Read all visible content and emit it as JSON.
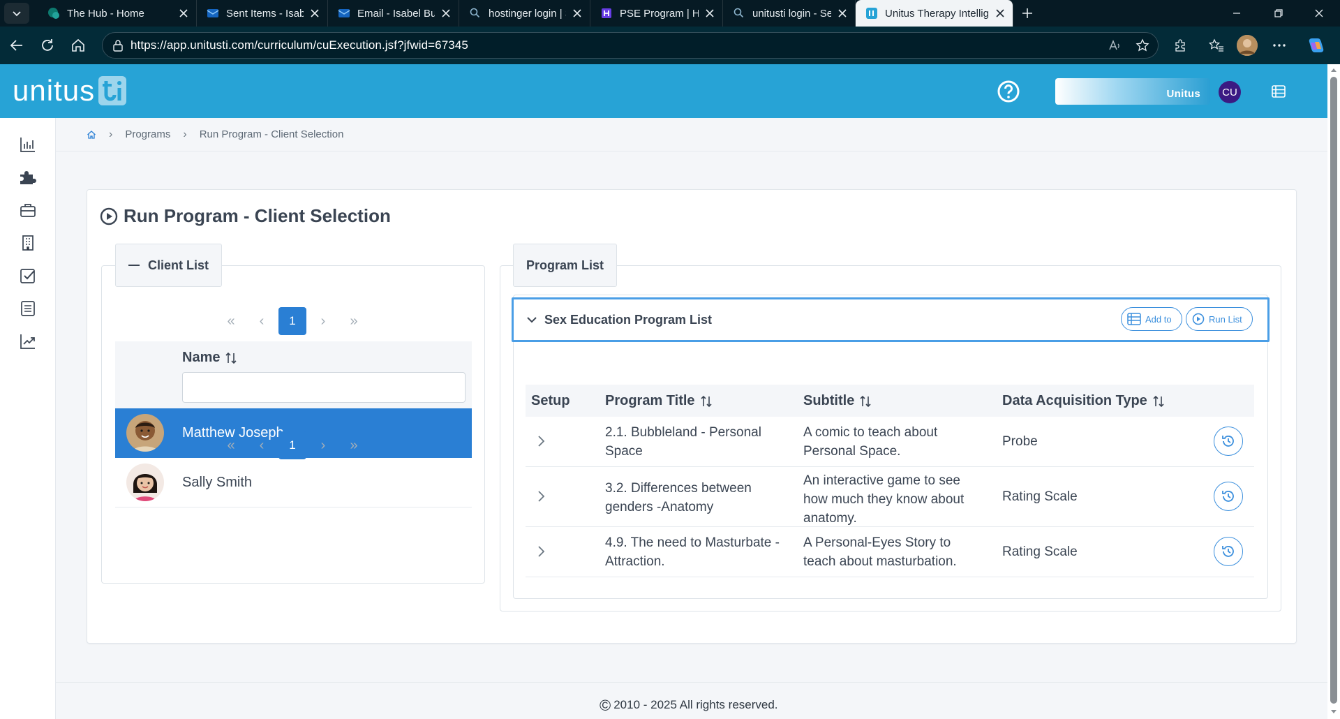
{
  "browser": {
    "tabs": [
      {
        "title": "The Hub - Home",
        "active": false
      },
      {
        "title": "Sent Items - Isabel Bullon",
        "active": false
      },
      {
        "title": "Email - Isabel Bullon Be",
        "active": false
      },
      {
        "title": "hostinger login | Sign in",
        "active": false
      },
      {
        "title": "PSE Program | Hostinger",
        "active": false
      },
      {
        "title": "unitusti login - Search",
        "active": false
      },
      {
        "title": "Unitus Therapy Intelligence",
        "active": true
      }
    ],
    "url": "https://app.unitusti.com/curriculum/cuExecution.jsf?jfwid=67345"
  },
  "header": {
    "logo_text": "unitus",
    "org_banner_text": "Unitus",
    "user_initials": "CU",
    "accent_color": "#27a3d6"
  },
  "sidebar": {
    "items": [
      {
        "icon": "bar-chart-icon"
      },
      {
        "icon": "puzzle-icon"
      },
      {
        "icon": "briefcase-icon"
      },
      {
        "icon": "building-icon"
      },
      {
        "icon": "checkbox-icon"
      },
      {
        "icon": "list-document-icon"
      },
      {
        "icon": "line-chart-icon"
      }
    ]
  },
  "breadcrumb": {
    "items": [
      "Programs",
      "Run Program - Client Selection"
    ]
  },
  "page": {
    "title": "Run Program - Client Selection"
  },
  "client_list": {
    "legend": "Client List",
    "current_page": "1",
    "name_header": "Name",
    "filter_value": "",
    "clients": [
      {
        "name": "Matthew Joseph",
        "selected": true
      },
      {
        "name": "Sally Smith",
        "selected": false
      }
    ]
  },
  "program_list": {
    "legend": "Program List",
    "accordion_title": "Sex Education Program List",
    "add_to_label": "Add to",
    "run_list_label": "Run List",
    "columns": {
      "setup": "Setup",
      "title": "Program Title",
      "subtitle": "Subtitle",
      "type": "Data Acquisition Type"
    },
    "rows": [
      {
        "title_lines": [
          "2.1. Bubbleland - Personal",
          "Space"
        ],
        "subtitle_lines": [
          "A comic to teach about",
          "Personal Space."
        ],
        "type": "Probe"
      },
      {
        "title_lines": [
          "3.2. Differences between",
          "genders -Anatomy"
        ],
        "subtitle_lines": [
          "An interactive game to see",
          "how much they know about",
          "anatomy."
        ],
        "type": "Rating Scale"
      },
      {
        "title_lines": [
          "4.9. The need to Masturbate -",
          "Attraction."
        ],
        "subtitle_lines": [
          "A Personal-Eyes Story to",
          "teach about masturbation."
        ],
        "type": "Rating Scale"
      }
    ]
  },
  "footer": {
    "text": "2010 - 2025 All rights reserved."
  }
}
